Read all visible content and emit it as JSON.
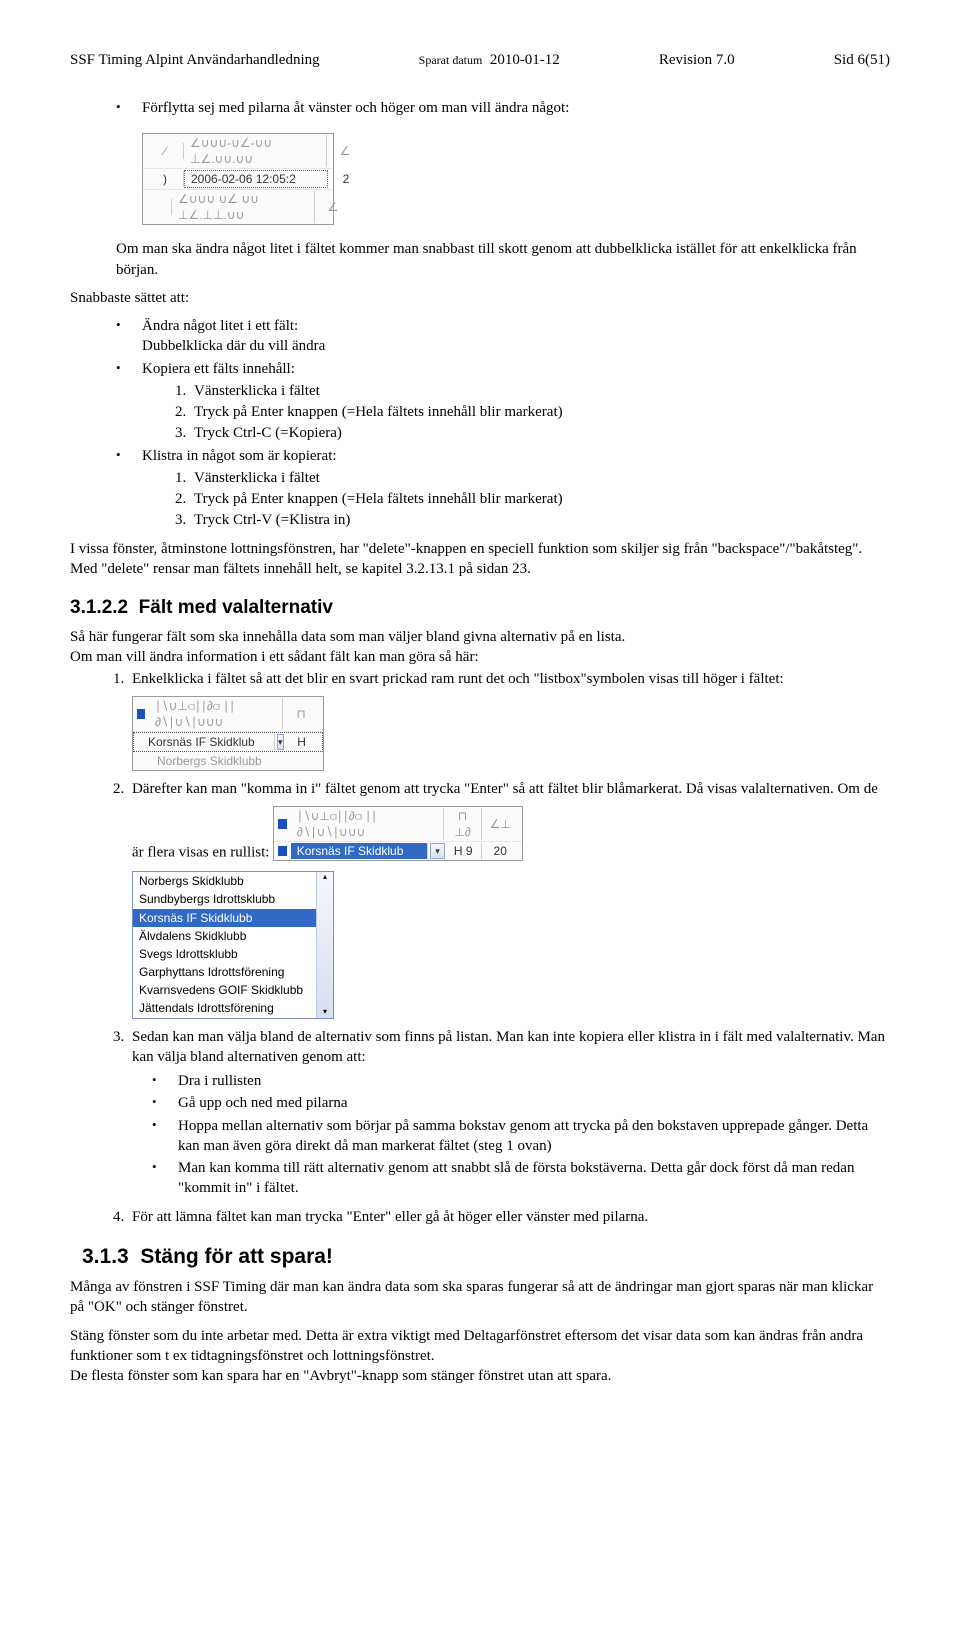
{
  "header": {
    "left": "SSF Timing Alpint Användarhandledning",
    "mid_label": "Sparat datum",
    "mid_date": "2010-01-12",
    "rev": "Revision 7.0",
    "page": "Sid 6(51)"
  },
  "intro_bullet": "Förflytta sej med pilarna åt vänster och höger om man vill ändra något:",
  "img1": {
    "r1": {
      "a": "∕",
      "b": "∠∪∪∪-∪∠-∪∪ ⊥∠.∪∪.∪∪",
      "c": "∠"
    },
    "r2": {
      "a": ")",
      "b": "2006-02-06 12:05:2",
      "c": "2"
    },
    "r3": {
      "sq": true,
      "b": "∠∪∪∪ ∪∠ ∪∪ ⊥∠.⊥⊥.∪∪",
      "c": "∠"
    }
  },
  "after_img1": "Om man ska ändra något litet i fältet kommer man snabbast till skott genom att dubbelklicka istället för att enkelklicka från början.",
  "snabbaste_title": "Snabbaste sättet att:",
  "sb": {
    "b1": "Ändra något litet i ett fält:",
    "b1a": "Dubbelklicka där du vill ändra",
    "b2": "Kopiera ett fälts innehåll:",
    "l1": "Vänsterklicka i fältet",
    "l2": "Tryck på Enter knappen (=Hela fältets innehåll blir markerat)",
    "l3": "Tryck Ctrl-C (=Kopiera)",
    "b3": "Klistra in något som är kopierat:",
    "l4": "Vänsterklicka i fältet",
    "l5": "Tryck på Enter knappen (=Hela fältets innehåll blir markerat)",
    "l6": "Tryck Ctrl-V (=Klistra in)"
  },
  "para_delete": "I vissa fönster, åtminstone lottningsfönstren, har \"delete\"-knappen en speciell funktion som skiljer sig från \"backspace\"/\"bakåtsteg\". Med \"delete\" rensar man fältets innehåll helt, se kapitel 3.2.13.1 på sidan 23.",
  "sec_3122_num": "3.1.2.2",
  "sec_3122_title": "Fält med valalternativ",
  "sec_3122_intro1": "Så här fungerar fält som ska innehålla data som man väljer bland givna alternativ på en lista.",
  "sec_3122_intro2": "Om man vill ändra information i ett sådant fält kan man göra så här:",
  "step1": "Enkelklicka i fältet så att det blir en svart prickad ram runt det och \"listbox\"symbolen visas till höger i fältet:",
  "img2": {
    "r1": {
      "a": "∣∖∪⊥⫏∣∣∂⫏ ∣∣  ∂∖∣∪∖∣∪∪∪",
      "b": "⊓"
    },
    "r2": {
      "a": "Korsnäs IF Skidklub",
      "b": "H"
    },
    "r3": {
      "a": "Norbergs Skidklubb"
    }
  },
  "step2": "Därefter kan man \"komma in i\" fältet genom att trycka \"Enter\" så att fältet blir blåmarkerat. Då visas valalternativen. Om de är flera visas en rullist:",
  "img3": {
    "topgrey": {
      "a": "∣∖∪⊥⫏∣∣∂⫏ ∣∣  ∂∖∣∪∖∣∪∪∪",
      "b": "⊓ ⊥∂",
      "c": "∠⊥"
    },
    "topsel": {
      "a": "Korsnäs IF Skidklub",
      "arrow": "▾",
      "b": "H 9",
      "c": "20"
    },
    "options": [
      "Norbergs Skidklubb",
      "Sundbybergs Idrottsklubb",
      "Korsnäs IF Skidklubb",
      "Älvdalens Skidklubb",
      "Svegs Idrottsklubb",
      "Garphyttans Idrottsförening",
      "Kvarnsvedens GOIF Skidklubb",
      "Jättendals Idrottsförening"
    ],
    "sel_index": 2
  },
  "step3_lead": "Sedan kan man välja bland de alternativ som finns på listan. Man kan inte kopiera eller klistra in i fält med valalternativ. Man kan välja bland alternativen genom att:",
  "step3_bullets": [
    "Dra i rullisten",
    "Gå upp och ned med pilarna",
    "Hoppa mellan alternativ som börjar på samma bokstav genom att trycka på den bokstaven upprepade gånger. Detta kan man även göra direkt då man markerat fältet (steg 1 ovan)",
    "Man kan komma till rätt alternativ genom att snabbt slå de första bokstäverna. Detta går dock först då man redan \"kommit in\" i fältet."
  ],
  "step4": "För att lämna fältet kan man trycka \"Enter\" eller gå åt höger eller vänster med pilarna.",
  "sec_313_num": "3.1.3",
  "sec_313_title": "Stäng för att spara!",
  "sec_313_p1": "Många av fönstren i SSF Timing där man kan ändra data som ska sparas fungerar så att de ändringar man gjort sparas när man klickar på \"OK\" och stänger fönstret.",
  "sec_313_p2": "Stäng fönster som du inte arbetar med. Detta är extra viktigt med Deltagarfönstret eftersom det visar data som kan ändras från andra funktioner som t ex tidtagningsfönstret och lottningsfönstret.",
  "sec_313_p3": "De flesta fönster som kan spara har en \"Avbryt\"-knapp som stänger fönstret utan att spara."
}
